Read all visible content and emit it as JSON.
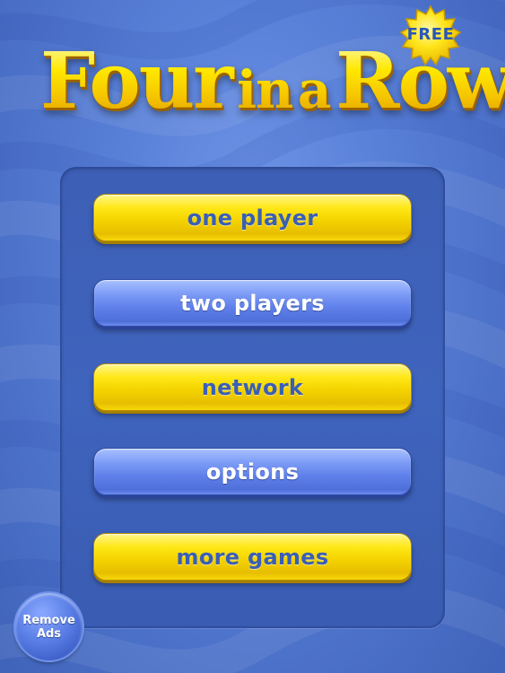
{
  "title": {
    "word1": "Four",
    "word2": "in",
    "word3": "a",
    "word4": "Row"
  },
  "badge": {
    "label": "FREE"
  },
  "menu": {
    "items": [
      {
        "label": "one player",
        "style": "yellow"
      },
      {
        "label": "two players",
        "style": "blue"
      },
      {
        "label": "network",
        "style": "yellow"
      },
      {
        "label": "options",
        "style": "blue"
      },
      {
        "label": "more games",
        "style": "yellow"
      }
    ]
  },
  "remove_ads": {
    "line1": "Remove",
    "line2": "Ads"
  },
  "colors": {
    "background": "#5a82d9",
    "panel": "#3f64bd",
    "yellow_button": "#f4d400",
    "blue_button": "#5f80ea",
    "title": "#ffe000"
  }
}
